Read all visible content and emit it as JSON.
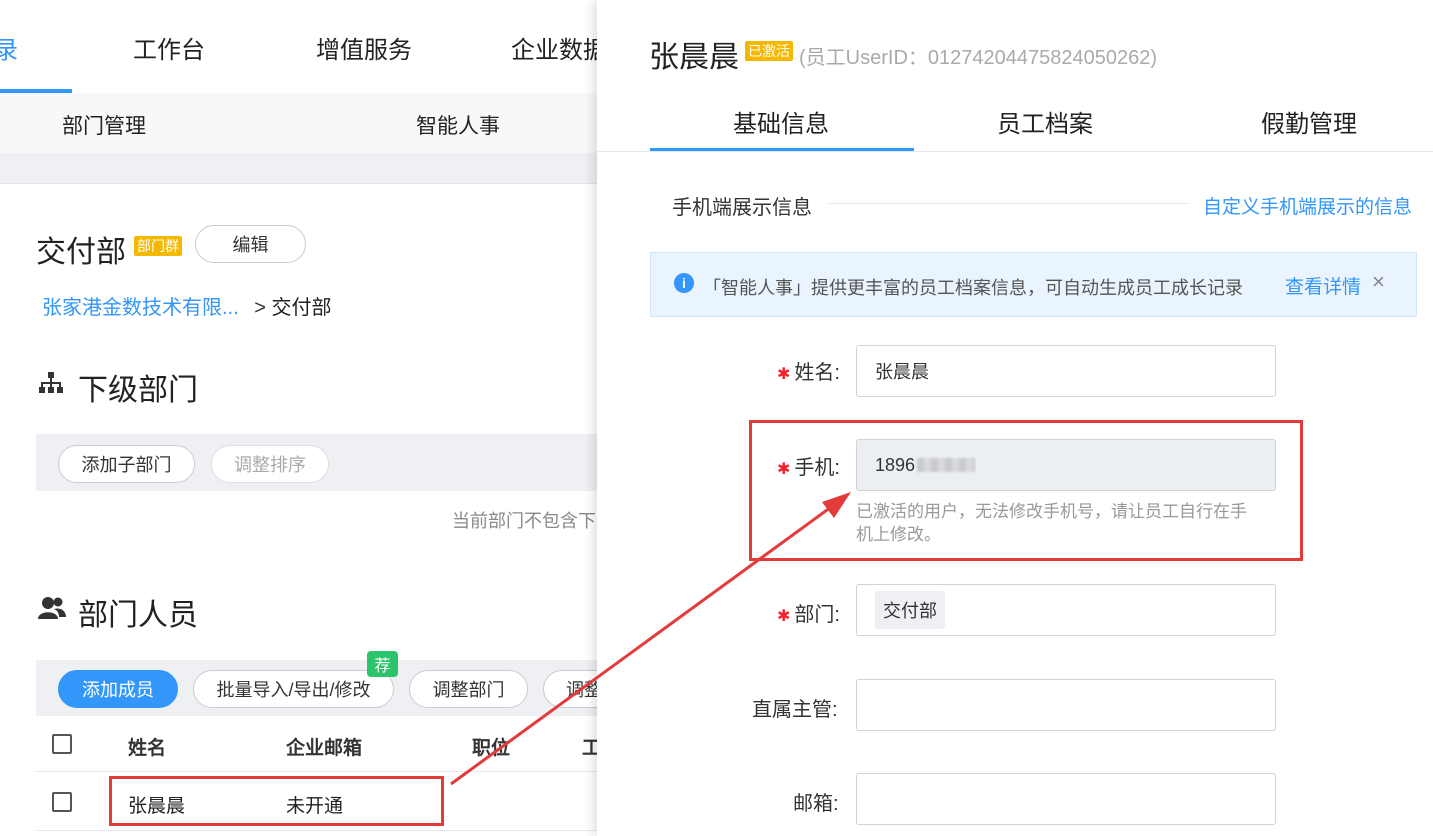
{
  "topnav": {
    "partial_first": "录",
    "items": [
      "工作台",
      "增值服务",
      "企业数据"
    ]
  },
  "subnav": {
    "items": [
      "部门管理",
      "智能人事"
    ]
  },
  "dept": {
    "name": "交付部",
    "group_tag": "部门群",
    "edit_label": "编辑",
    "breadcrumb_company": "张家港金数技术有限...",
    "breadcrumb_sep": ">",
    "breadcrumb_current": "交付部"
  },
  "subdept": {
    "title": "下级部门",
    "add_label": "添加子部门",
    "sort_label": "调整排序",
    "empty_text": "当前部门不包含下"
  },
  "members": {
    "title": "部门人员",
    "add_label": "添加成员",
    "batch_label": "批量导入/导出/修改",
    "recommend_badge": "荐",
    "adjust_dept_label": "调整部门",
    "more_label": "调整",
    "columns": [
      "姓名",
      "企业邮箱",
      "职位",
      "工"
    ],
    "rows": [
      {
        "name": "张晨晨",
        "email": "未开通"
      }
    ]
  },
  "panel": {
    "name": "张晨晨",
    "status": "已激活",
    "userid_text": "(员工UserID：01274204475824050262)",
    "tabs": [
      "基础信息",
      "员工档案",
      "假勤管理"
    ],
    "mobile_display_title": "手机端展示信息",
    "customize_link": "自定义手机端展示的信息",
    "notice": {
      "text": "「智能人事」提供更丰富的员工档案信息，可自动生成员工成长记录",
      "link": "查看详情",
      "close": "×"
    },
    "form": {
      "name_label": "姓名:",
      "name_value": "张晨晨",
      "phone_label": "手机:",
      "phone_value": "1896",
      "phone_hint_line1": "已激活的用户，无法修改手机号，请让员工自行在手",
      "phone_hint_line2": "机上修改。",
      "dept_label": "部门:",
      "dept_value": "交付部",
      "manager_label": "直属主管:",
      "email_label": "邮箱:"
    }
  },
  "colors": {
    "accent": "#3296fa",
    "highlight": "#e33a3a",
    "active_tag": "#f5b800",
    "recommend": "#2bc36b"
  }
}
